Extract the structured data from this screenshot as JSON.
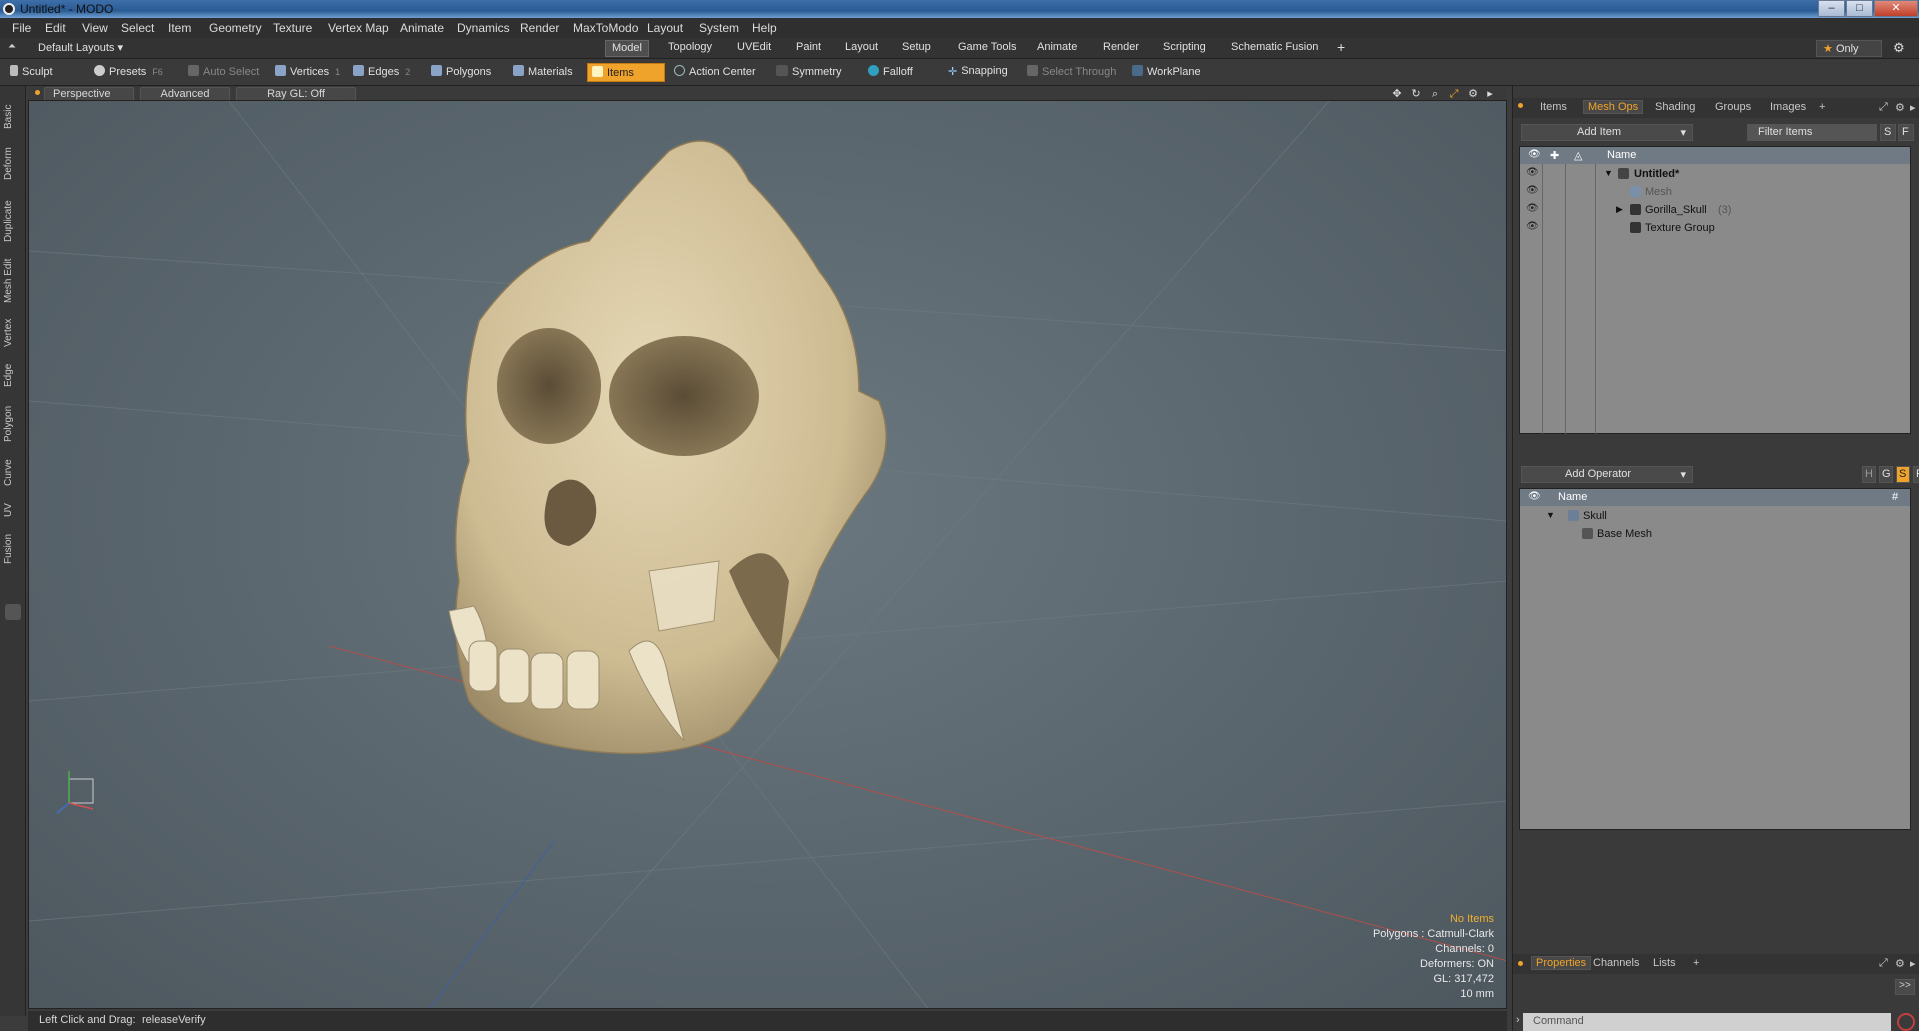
{
  "window": {
    "title": "Untitled* - MODO"
  },
  "menu": [
    "File",
    "Edit",
    "View",
    "Select",
    "Item",
    "Geometry",
    "Texture",
    "Vertex Map",
    "Animate",
    "Dynamics",
    "Render",
    "MaxToModo",
    "Layout",
    "System",
    "Help"
  ],
  "layout": {
    "default_layouts": "Default Layouts",
    "tabs": [
      "Model",
      "Topology",
      "UVEdit",
      "Paint",
      "Layout",
      "Setup",
      "Game Tools",
      "Animate",
      "Render",
      "Scripting",
      "Schematic Fusion"
    ],
    "active_tab": "Model",
    "add_tab": "+",
    "only_label": "Only"
  },
  "toolbar": {
    "sculpt": "Sculpt",
    "presets": "Presets",
    "presets_key": "F6",
    "auto_select": "Auto Select",
    "vertices": "Vertices",
    "vertices_key": "1",
    "edges": "Edges",
    "edges_key": "2",
    "polygons": "Polygons",
    "materials": "Materials",
    "items": "Items",
    "action_center": "Action Center",
    "symmetry": "Symmetry",
    "falloff": "Falloff",
    "snapping": "Snapping",
    "select_through": "Select Through",
    "workplane": "WorkPlane"
  },
  "left_tabs": [
    "Basic",
    "Deform",
    "Duplicate",
    "Mesh Edit",
    "Vertex",
    "Edge",
    "Polygon",
    "Curve",
    "UV",
    "Fusion"
  ],
  "viewport": {
    "perspective": "Perspective",
    "advanced": "Advanced",
    "raygl": "Ray GL: Off",
    "info": {
      "no_items": "No Items",
      "polygons": "Polygons : Catmull-Clark",
      "channels": "Channels: 0",
      "deformers": "Deformers: ON",
      "gl": "GL: 317,472",
      "scale": "10 mm"
    }
  },
  "status": {
    "hint": "Left Click and Drag:",
    "value": "releaseVerify"
  },
  "right_panel": {
    "tabs": [
      "Items",
      "Mesh Ops",
      "Shading",
      "Groups",
      "Images",
      "+"
    ],
    "active_tab": "Mesh Ops",
    "add_item": "Add Item",
    "filter_items": "Filter Items",
    "s_btn": "S",
    "f_btn": "F",
    "name_header": "Name",
    "items": [
      {
        "label": "Untitled*",
        "bold": true
      },
      {
        "label": "Mesh",
        "dim": true
      },
      {
        "label": "Gorilla_Skull",
        "count": "(3)"
      },
      {
        "label": "Texture Group"
      }
    ],
    "add_operator": "Add Operator",
    "h_btn": "H",
    "g_btn": "G",
    "op_name_header": "Name",
    "op_hash": "#",
    "operators": [
      {
        "label": "Skull"
      },
      {
        "label": "Base Mesh"
      }
    ],
    "bottom_tabs": [
      "Properties",
      "Channels",
      "Lists",
      "+"
    ],
    "bottom_active": "Properties",
    "command_placeholder": "Command",
    "expand": ">>"
  },
  "colors": {
    "accent": "#f0a32a",
    "skull": "#d9c9a3"
  }
}
